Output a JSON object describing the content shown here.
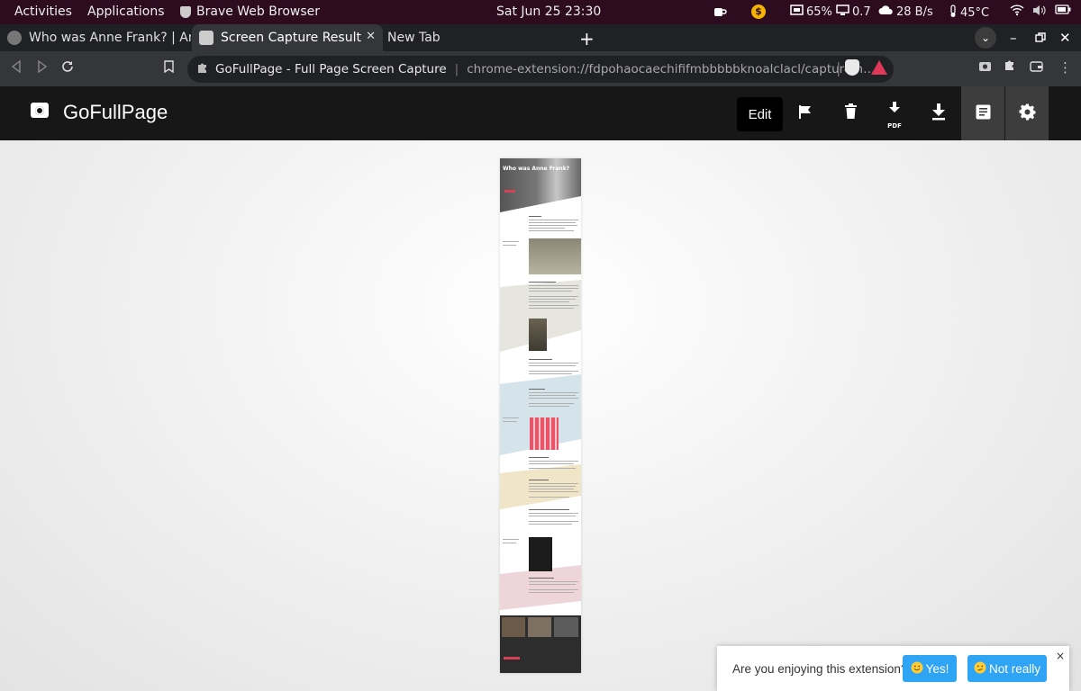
{
  "system_bar": {
    "activities": "Activities",
    "applications": "Applications",
    "app_name": "Brave Web Browser",
    "clock": "Sat Jun 25  23:30",
    "cpu": "65%",
    "load": "0.7",
    "network": "28 B/s",
    "temperature": "45°C"
  },
  "tabs": [
    {
      "title": "Who was Anne Frank? | Anne",
      "active": false
    },
    {
      "title": "Screen Capture Result",
      "active": true
    },
    {
      "title": "New Tab",
      "active": false
    }
  ],
  "address_bar": {
    "page_title": "GoFullPage - Full Page Screen Capture",
    "url": "chrome-extension://fdpohaocaechififmbbbbbknoalclacl/capture.html?id=22&url..."
  },
  "extension": {
    "name": "GoFullPage",
    "edit_label": "Edit",
    "pdf_label": "PDF"
  },
  "capture_preview": {
    "heading": "Who was Anne Frank?"
  },
  "feedback": {
    "question": "Are you enjoying this extension?",
    "yes_label": "Yes!",
    "no_label": "Not really",
    "close_label": "×"
  },
  "icons": {
    "yes": "smile-icon",
    "no": "confused-icon"
  }
}
